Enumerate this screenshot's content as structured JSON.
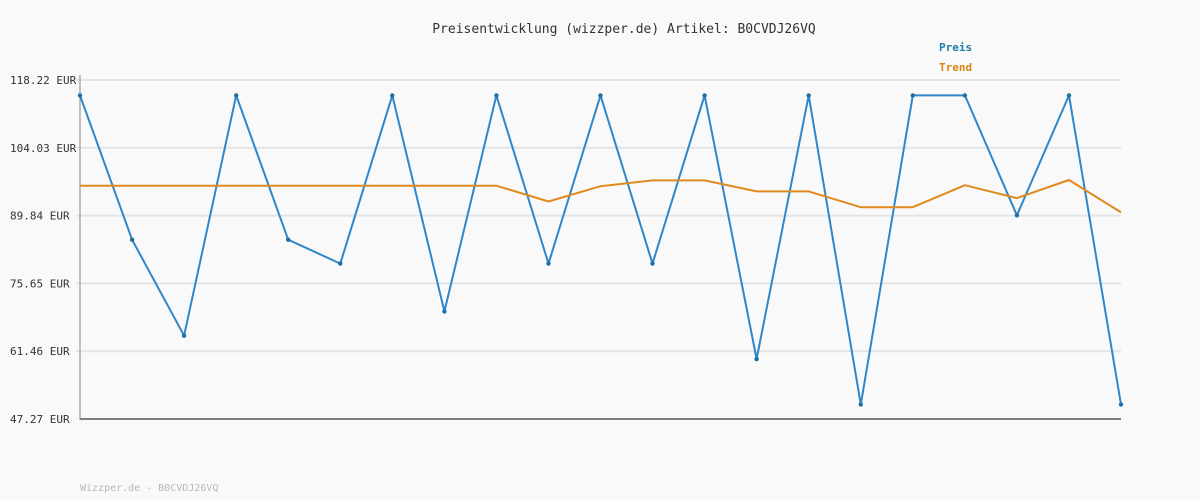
{
  "chart_data": {
    "type": "line",
    "title": "Preisentwicklung (wizzper.de) Artikel: B0CVDJ26VQ",
    "xlabel": "",
    "ylabel": "",
    "ylim": [
      47.27,
      118.22
    ],
    "y_ticks": [
      "118.22 EUR",
      "104.03 EUR",
      "89.84 EUR",
      "75.65 EUR",
      "61.46 EUR",
      "47.27 EUR"
    ],
    "y_tick_values": [
      118.22,
      104.03,
      89.84,
      75.65,
      61.46,
      47.27
    ],
    "grid": true,
    "legend_position": "top-right",
    "x": [
      0,
      1,
      2,
      3,
      4,
      5,
      6,
      7,
      8,
      9,
      10,
      11,
      12,
      13,
      14,
      15,
      16,
      17,
      18,
      19,
      20,
      21
    ],
    "series": [
      {
        "name": "Preis",
        "color": "#2f86c8",
        "values": [
          115.0,
          84.8,
          64.7,
          115.0,
          84.8,
          79.8,
          115.0,
          69.8,
          115.0,
          79.8,
          115.0,
          79.8,
          115.0,
          59.8,
          115.0,
          50.3,
          115.0,
          115.0,
          89.9,
          115.0,
          50.3
        ]
      },
      {
        "name": "Trend",
        "color": "#e08a1e",
        "values": [
          96.1,
          96.1,
          96.1,
          96.1,
          96.1,
          96.1,
          96.1,
          96.1,
          96.1,
          92.8,
          96.0,
          97.2,
          97.2,
          94.9,
          94.9,
          91.6,
          91.6,
          96.2,
          93.5,
          97.3,
          90.5
        ]
      }
    ],
    "legend_colors": {
      "Preis": "#1f7ab0",
      "Trend": "#d98612"
    }
  },
  "footer": "Wizzper.de - B0CVDJ26VQ"
}
